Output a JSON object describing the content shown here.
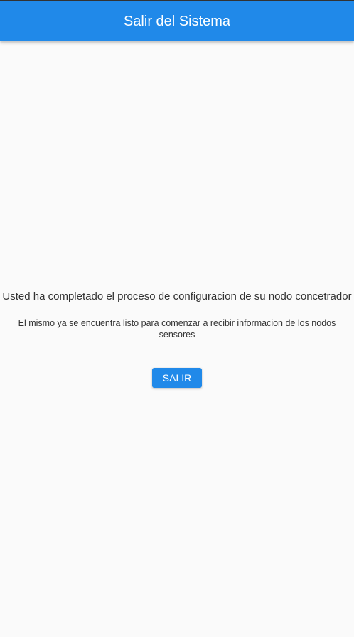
{
  "appbar": {
    "title": "Salir del Sistema",
    "color": "#2089e9"
  },
  "main": {
    "message": "Usted ha completado el proceso de configuracion de su nodo concetrador",
    "submessage": "El mismo ya se encuentra listo para comenzar a recibir informacion de los nodos sensores",
    "exit_button": "SALIR"
  }
}
